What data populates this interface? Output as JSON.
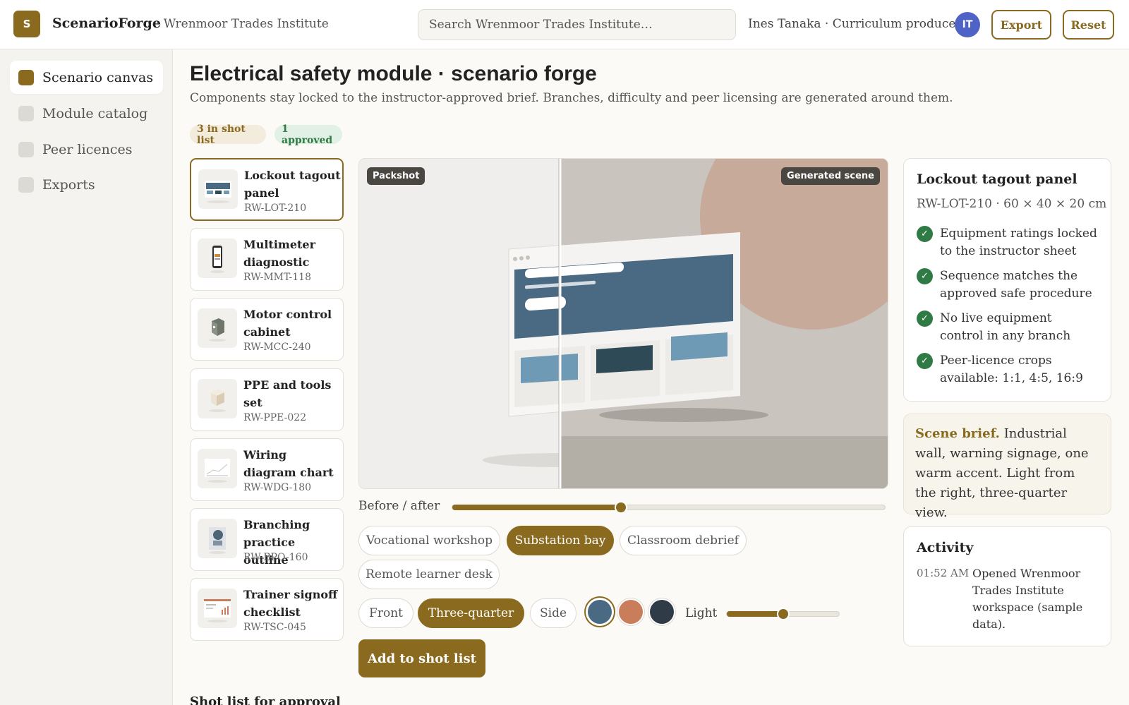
{
  "app": {
    "logo_letter": "S",
    "name": "ScenarioForge",
    "org": "· Wrenmoor Trades Institute",
    "search_placeholder": "Search Wrenmoor Trades Institute…",
    "user": "Ines Tanaka · Curriculum producer",
    "avatar_initials": "IT",
    "export_label": "Export",
    "reset_label": "Reset",
    "accent_color": "#8a6a1f"
  },
  "sidebar": {
    "items": [
      {
        "label": "Scenario canvas",
        "active": true
      },
      {
        "label": "Module catalog",
        "active": false
      },
      {
        "label": "Peer licences",
        "active": false
      },
      {
        "label": "Exports",
        "active": false
      }
    ]
  },
  "page": {
    "title": "Electrical safety module · scenario forge",
    "subtitle": "Components stay locked to the instructor-approved brief. Branches, difficulty and peer licensing are generated around them.",
    "badge_shotlist": "3 in shot list",
    "badge_approved": "1 approved"
  },
  "components": [
    {
      "name": "Lockout tagout panel",
      "sku": "RW-LOT-210",
      "icon": "panel-thumbnail",
      "selected": true
    },
    {
      "name": "Multimeter diagnostic",
      "sku": "RW-MMT-118",
      "icon": "phone-thumbnail",
      "selected": false
    },
    {
      "name": "Motor control cabinet",
      "sku": "RW-MCC-240",
      "icon": "cabinet-thumbnail",
      "selected": false
    },
    {
      "name": "PPE and tools set",
      "sku": "RW-PPE-022",
      "icon": "box-thumbnail",
      "selected": false
    },
    {
      "name": "Wiring diagram chart",
      "sku": "RW-WDG-180",
      "icon": "chart-thumbnail",
      "selected": false
    },
    {
      "name": "Branching practice outline",
      "sku": "RW-BPO-160",
      "icon": "outline-thumbnail",
      "selected": false
    },
    {
      "name": "Trainer signoff checklist",
      "sku": "RW-TSC-045",
      "icon": "checklist-thumbnail",
      "selected": false
    }
  ],
  "preview": {
    "packshot_label": "Packshot",
    "generated_label": "Generated scene",
    "before_after_label": "Before / after",
    "before_after_value": 0.39
  },
  "scenes": [
    {
      "label": "Vocational workshop",
      "active": false
    },
    {
      "label": "Substation bay",
      "active": true
    },
    {
      "label": "Classroom debrief",
      "active": false
    },
    {
      "label": "Remote learner desk",
      "active": false
    }
  ],
  "angles": [
    {
      "label": "Front",
      "active": false
    },
    {
      "label": "Three-quarter",
      "active": true
    },
    {
      "label": "Side",
      "active": false
    }
  ],
  "swatches": [
    {
      "name": "slate-blue",
      "color": "#4a6a83",
      "selected": true
    },
    {
      "name": "terracotta",
      "color": "#c97d5a",
      "selected": false
    },
    {
      "name": "charcoal",
      "color": "#2f3b47",
      "selected": false
    }
  ],
  "light": {
    "label": "Light",
    "value": 0.5
  },
  "add_button": "Add to shot list",
  "shot_list_title": "Shot list for approval",
  "detail": {
    "title": "Lockout tagout panel",
    "sub": "RW-LOT-210 · 60 × 40 × 20 cm",
    "checks": [
      "Equipment ratings locked to the instructor sheet",
      "Sequence matches the approved safe procedure",
      "No live equipment control in any branch",
      "Peer-licence crops available: 1:1, 4:5, 16:9"
    ]
  },
  "brief": {
    "lead": "Scene brief.",
    "text": "Industrial wall, warning signage, one warm accent. Light from the right, three-quarter view."
  },
  "activity": {
    "title": "Activity",
    "time": "01:52 AM",
    "text": "Opened Wrenmoor Trades Institute workspace (sample data)."
  }
}
